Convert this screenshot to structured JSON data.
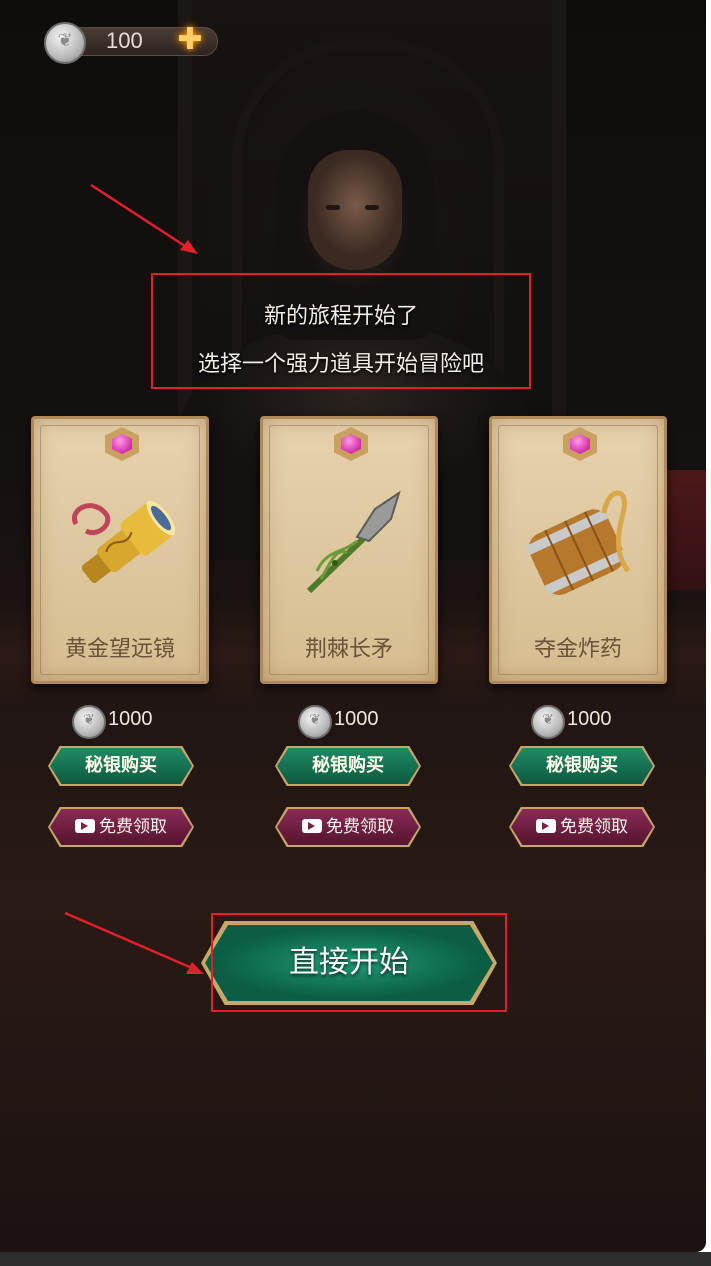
{
  "hud": {
    "currency_amount": "100",
    "currency_icon": "silver-coin-icon",
    "add_icon": "plus-icon"
  },
  "message": {
    "line1": "新的旅程开始了",
    "line2": "选择一个强力道具开始冒险吧"
  },
  "cards": [
    {
      "name": "黄金望远镜",
      "icon": "golden-telescope-icon",
      "price": "1000",
      "buy_label": "秘银购买",
      "free_label": "免费领取"
    },
    {
      "name": "荆棘长矛",
      "icon": "thorn-spear-icon",
      "price": "1000",
      "buy_label": "秘银购买",
      "free_label": "免费领取"
    },
    {
      "name": "夺金炸药",
      "icon": "gunpowder-barrel-icon",
      "price": "1000",
      "buy_label": "秘银购买",
      "free_label": "免费领取"
    }
  ],
  "start_button": {
    "label": "直接开始"
  },
  "colors": {
    "highlight_box": "#e0202a",
    "buy_button": "#0e5a40",
    "free_button": "#55142f"
  }
}
